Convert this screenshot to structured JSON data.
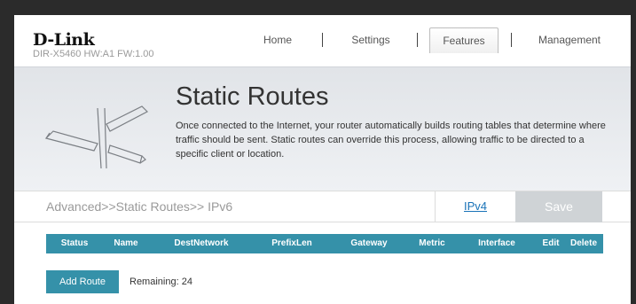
{
  "header": {
    "logo": "D-Link",
    "model": "DIR-X5460 HW:A1 FW:1.00",
    "nav": [
      {
        "label": "Home"
      },
      {
        "label": "Settings"
      },
      {
        "label": "Features",
        "active": true
      },
      {
        "label": "Management"
      }
    ]
  },
  "banner": {
    "title": "Static Routes",
    "description": "Once connected to the Internet, your router automatically builds routing tables that determine where traffic should be sent. Static routes can override this process, allowing traffic to be directed to a specific client or location.",
    "icon": "signpost-icon"
  },
  "breadcrumb": "Advanced>>Static Routes>> IPv6",
  "ipv4_label": "IPv4",
  "save_label": "Save",
  "table": {
    "columns": [
      "Status",
      "Name",
      "DestNetwork",
      "PrefixLen",
      "Gateway",
      "Metric",
      "Interface",
      "Edit",
      "Delete"
    ]
  },
  "add_route_label": "Add Route",
  "remaining": "Remaining: 24",
  "colors": {
    "accent": "#3591a9",
    "save_disabled": "#cfd3d6",
    "link": "#1a73b8"
  }
}
